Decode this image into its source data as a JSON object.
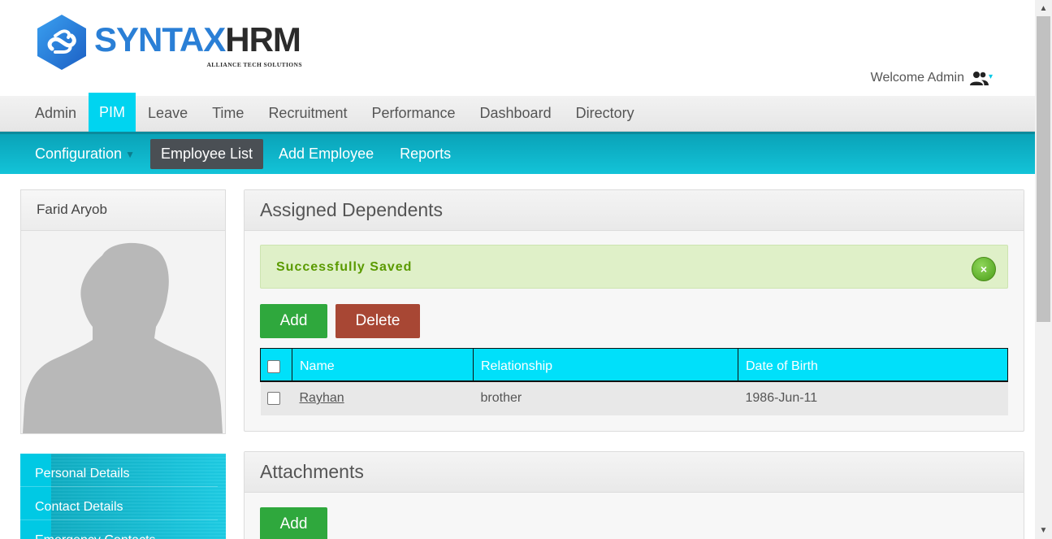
{
  "brand": {
    "name_part1": "SYNTAX",
    "name_part2": "HRM",
    "tagline": "ALLIANCE TECH SOLUTIONS",
    "colors": {
      "blue": "#2a7fd6",
      "dark": "#2b2b2b"
    }
  },
  "header": {
    "welcome": "Welcome Admin",
    "user_icon": "users-icon",
    "caret": "▾"
  },
  "main_nav": {
    "items": [
      {
        "label": "Admin",
        "active": false
      },
      {
        "label": "PIM",
        "active": true
      },
      {
        "label": "Leave",
        "active": false
      },
      {
        "label": "Time",
        "active": false
      },
      {
        "label": "Recruitment",
        "active": false
      },
      {
        "label": "Performance",
        "active": false
      },
      {
        "label": "Dashboard",
        "active": false
      },
      {
        "label": "Directory",
        "active": false
      }
    ]
  },
  "sub_nav": {
    "configuration": "Configuration",
    "employee_list": "Employee List",
    "add_employee": "Add Employee",
    "reports": "Reports"
  },
  "profile": {
    "name": "Farid Aryob",
    "photo": "default-avatar-silhouette"
  },
  "side_menu": {
    "items": [
      "Personal Details",
      "Contact Details",
      "Emergency Contacts"
    ]
  },
  "dependents": {
    "title": "Assigned Dependents",
    "alert": "Successfully Saved",
    "close_symbol": "×",
    "add_label": "Add",
    "delete_label": "Delete",
    "columns": [
      "Name",
      "Relationship",
      "Date of Birth"
    ],
    "rows": [
      {
        "name": "Rayhan",
        "relationship": "brother",
        "dob": "1986-Jun-11"
      }
    ]
  },
  "attachments": {
    "title": "Attachments",
    "add_label": "Add"
  },
  "colors": {
    "accent": "#00d4f0",
    "subnav": "#13c3d8",
    "success": "#2fa83d",
    "danger": "#a84734",
    "alert_bg": "#dff0c8"
  }
}
